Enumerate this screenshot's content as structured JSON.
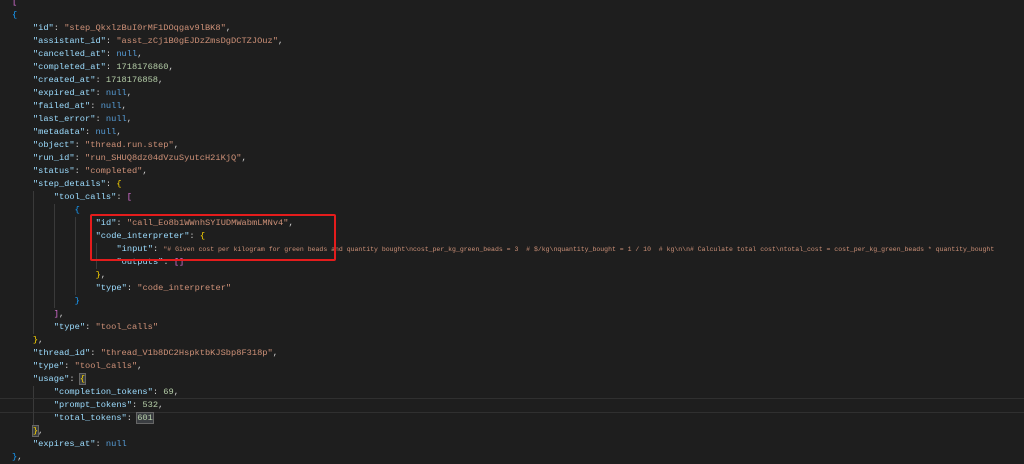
{
  "colors": {
    "background": "#1e1e1e",
    "key": "#9cdcfe",
    "string": "#ce9178",
    "number": "#b5cea8",
    "keyword": "#569cd6",
    "highlight_box": "#e51c1c"
  },
  "cursor_line": 31,
  "lines": [
    {
      "i": 0,
      "t": [
        [
          "b2",
          "["
        ]
      ]
    },
    {
      "i": 0,
      "t": [
        [
          "b3",
          "{"
        ]
      ]
    },
    {
      "i": 1,
      "t": [
        [
          "k",
          "\"id\""
        ],
        [
          "p",
          ": "
        ],
        [
          "s",
          "\"step_QkxlzBuI0rMF1DOqgav9lBK8\""
        ],
        [
          "p",
          ","
        ]
      ]
    },
    {
      "i": 1,
      "t": [
        [
          "k",
          "\"assistant_id\""
        ],
        [
          "p",
          ": "
        ],
        [
          "s",
          "\"asst_zCj1B0gEJDzZmsDgDCTZJOuz\""
        ],
        [
          "p",
          ","
        ]
      ]
    },
    {
      "i": 1,
      "t": [
        [
          "k",
          "\"cancelled_at\""
        ],
        [
          "p",
          ": "
        ],
        [
          "l",
          "null"
        ],
        [
          "p",
          ","
        ]
      ]
    },
    {
      "i": 1,
      "t": [
        [
          "k",
          "\"completed_at\""
        ],
        [
          "p",
          ": "
        ],
        [
          "n",
          "1718176860"
        ],
        [
          "p",
          ","
        ]
      ]
    },
    {
      "i": 1,
      "t": [
        [
          "k",
          "\"created_at\""
        ],
        [
          "p",
          ": "
        ],
        [
          "n",
          "1718176858"
        ],
        [
          "p",
          ","
        ]
      ]
    },
    {
      "i": 1,
      "t": [
        [
          "k",
          "\"expired_at\""
        ],
        [
          "p",
          ": "
        ],
        [
          "l",
          "null"
        ],
        [
          "p",
          ","
        ]
      ]
    },
    {
      "i": 1,
      "t": [
        [
          "k",
          "\"failed_at\""
        ],
        [
          "p",
          ": "
        ],
        [
          "l",
          "null"
        ],
        [
          "p",
          ","
        ]
      ]
    },
    {
      "i": 1,
      "t": [
        [
          "k",
          "\"last_error\""
        ],
        [
          "p",
          ": "
        ],
        [
          "l",
          "null"
        ],
        [
          "p",
          ","
        ]
      ]
    },
    {
      "i": 1,
      "t": [
        [
          "k",
          "\"metadata\""
        ],
        [
          "p",
          ": "
        ],
        [
          "l",
          "null"
        ],
        [
          "p",
          ","
        ]
      ]
    },
    {
      "i": 1,
      "t": [
        [
          "k",
          "\"object\""
        ],
        [
          "p",
          ": "
        ],
        [
          "s",
          "\"thread.run.step\""
        ],
        [
          "p",
          ","
        ]
      ]
    },
    {
      "i": 1,
      "t": [
        [
          "k",
          "\"run_id\""
        ],
        [
          "p",
          ": "
        ],
        [
          "s",
          "\"run_SHUQ8dz04dVzuSyutcH2iKjQ\""
        ],
        [
          "p",
          ","
        ]
      ]
    },
    {
      "i": 1,
      "t": [
        [
          "k",
          "\"status\""
        ],
        [
          "p",
          ": "
        ],
        [
          "s",
          "\"completed\""
        ],
        [
          "p",
          ","
        ]
      ]
    },
    {
      "i": 1,
      "t": [
        [
          "k",
          "\"step_details\""
        ],
        [
          "p",
          ": "
        ],
        [
          "b1",
          "{"
        ]
      ]
    },
    {
      "i": 2,
      "t": [
        [
          "k",
          "\"tool_calls\""
        ],
        [
          "p",
          ": "
        ],
        [
          "b2",
          "["
        ]
      ]
    },
    {
      "i": 3,
      "t": [
        [
          "b3",
          "{"
        ]
      ]
    },
    {
      "i": 4,
      "t": [
        [
          "k",
          "\"id\""
        ],
        [
          "p",
          ": "
        ],
        [
          "s",
          "\"call_Eo8b1WWnhSYIUDMWabmLMNv4\""
        ],
        [
          "p",
          ","
        ]
      ]
    },
    {
      "i": 4,
      "t": [
        [
          "k",
          "\"code_interpreter\""
        ],
        [
          "p",
          ": "
        ],
        [
          "b1",
          "{"
        ]
      ]
    },
    {
      "i": 5,
      "t": [
        [
          "k",
          "\"input\""
        ],
        [
          "p",
          ": "
        ],
        [
          "s",
          "\"# Given cost per kilogram for green beads and quantity bought\\ncost_per_kg_green_beads = 3  # $/kg\\nquantity_bought = 1 / 10  # kg\\n\\n# Calculate total cost\\ntotal_cost = cost_per_kg_green_beads * quantity_bought"
        ]
      ]
    },
    {
      "i": 5,
      "t": [
        [
          "k",
          "\"outputs\""
        ],
        [
          "p",
          ": "
        ],
        [
          "b2",
          "[]"
        ]
      ]
    },
    {
      "i": 4,
      "t": [
        [
          "b1",
          "}"
        ],
        [
          "p",
          ","
        ]
      ]
    },
    {
      "i": 4,
      "t": [
        [
          "k",
          "\"type\""
        ],
        [
          "p",
          ": "
        ],
        [
          "s",
          "\"code_interpreter\""
        ]
      ]
    },
    {
      "i": 3,
      "t": [
        [
          "b3",
          "}"
        ]
      ]
    },
    {
      "i": 2,
      "t": [
        [
          "b2",
          "]"
        ],
        [
          "p",
          ","
        ]
      ]
    },
    {
      "i": 2,
      "t": [
        [
          "k",
          "\"type\""
        ],
        [
          "p",
          ": "
        ],
        [
          "s",
          "\"tool_calls\""
        ]
      ]
    },
    {
      "i": 1,
      "t": [
        [
          "b1",
          "}"
        ],
        [
          "p",
          ","
        ]
      ]
    },
    {
      "i": 1,
      "t": [
        [
          "k",
          "\"thread_id\""
        ],
        [
          "p",
          ": "
        ],
        [
          "s",
          "\"thread_V1b8DC2HspktbKJSbp8F318p\""
        ],
        [
          "p",
          ","
        ]
      ]
    },
    {
      "i": 1,
      "t": [
        [
          "k",
          "\"type\""
        ],
        [
          "p",
          ": "
        ],
        [
          "s",
          "\"tool_calls\""
        ],
        [
          "p",
          ","
        ]
      ]
    },
    {
      "i": 1,
      "t": [
        [
          "k",
          "\"usage\""
        ],
        [
          "p",
          ": "
        ],
        [
          "b1 hl",
          "{"
        ]
      ]
    },
    {
      "i": 2,
      "t": [
        [
          "k",
          "\"completion_tokens\""
        ],
        [
          "p",
          ": "
        ],
        [
          "n",
          "69"
        ],
        [
          "p",
          ","
        ]
      ]
    },
    {
      "i": 2,
      "t": [
        [
          "k",
          "\"prompt_tokens\""
        ],
        [
          "p",
          ": "
        ],
        [
          "n",
          "532"
        ],
        [
          "p",
          ","
        ]
      ]
    },
    {
      "i": 2,
      "t": [
        [
          "k",
          "\"total_tokens\""
        ],
        [
          "p",
          ": "
        ],
        [
          "n hl",
          "601"
        ]
      ]
    },
    {
      "i": 1,
      "t": [
        [
          "b1 hl",
          "}"
        ],
        [
          "p",
          ","
        ]
      ]
    },
    {
      "i": 1,
      "t": [
        [
          "k",
          "\"expires_at\""
        ],
        [
          "p",
          ": "
        ],
        [
          "l",
          "null"
        ]
      ]
    },
    {
      "i": 0,
      "t": [
        [
          "b3",
          "}"
        ],
        [
          "p",
          ","
        ]
      ]
    }
  ]
}
